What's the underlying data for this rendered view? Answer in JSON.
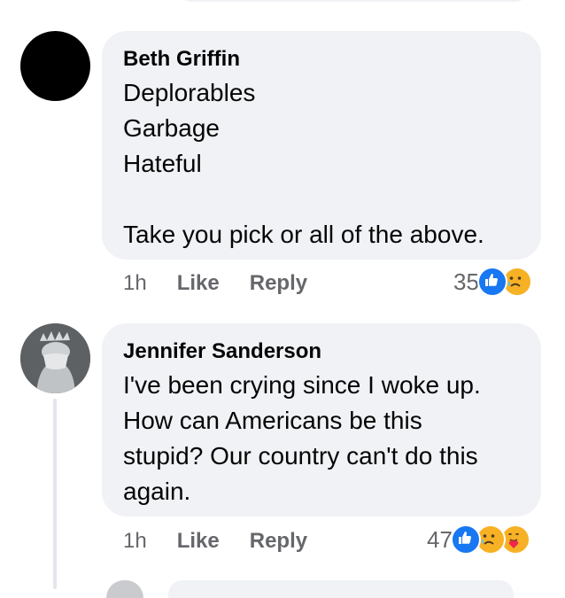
{
  "colors": {
    "bubble_bg": "#f0f2f5",
    "meta_text": "#65676b",
    "like_blue": "#1877f2",
    "emoji_yellow": "#f7b125"
  },
  "comments": [
    {
      "author": "Beth Griffin",
      "lines": [
        "Deplorables",
        "Garbage",
        "Hateful",
        "",
        "Take you pick or all of the above."
      ],
      "time": "1h",
      "like_label": "Like",
      "reply_label": "Reply",
      "reaction_count": "35",
      "reactions": [
        "like-icon",
        "sad-icon"
      ]
    },
    {
      "author": "Jennifer Sanderson",
      "lines": [
        "I've been crying since I woke up.",
        "How can Americans be this",
        "stupid? Our country can't do this",
        "again."
      ],
      "time": "1h",
      "like_label": "Like",
      "reply_label": "Reply",
      "reaction_count": "47",
      "reactions": [
        "like-icon",
        "sad-icon",
        "care-icon"
      ]
    }
  ]
}
